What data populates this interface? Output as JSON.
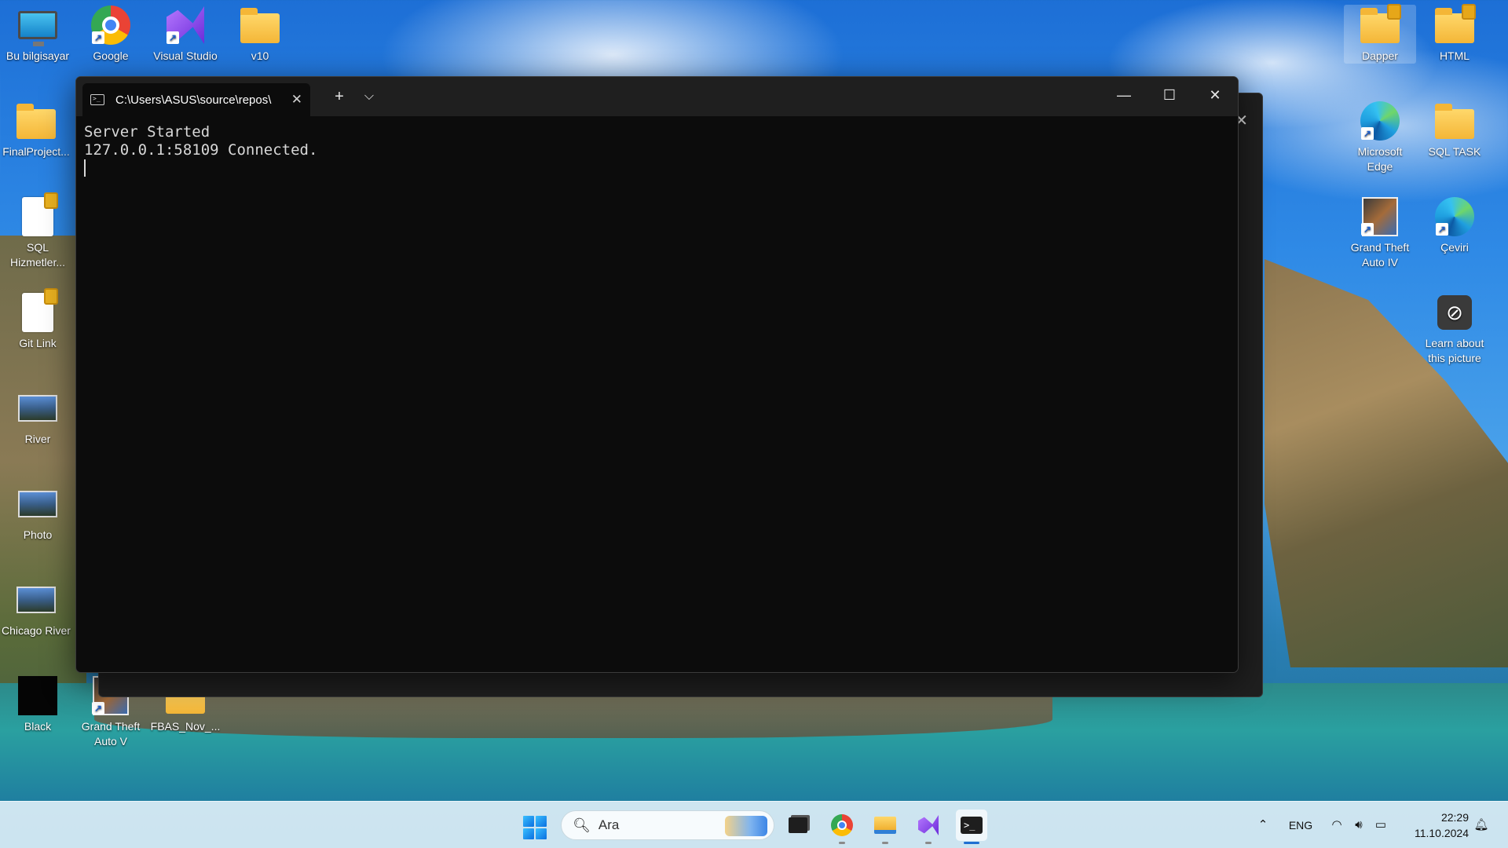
{
  "desktop": {
    "icons_left": [
      {
        "label": "Bu bilgisayar",
        "icon": "computer-icon"
      },
      {
        "label": "Google Chrome",
        "icon": "chrome-icon"
      },
      {
        "label": "Visual Studio 2022",
        "icon": "visual-studio-icon"
      },
      {
        "label": "v10",
        "icon": "folder-icon"
      },
      {
        "label": "FinalProject...",
        "icon": "folder-icon"
      },
      {
        "label": "SQL Hizmetler...",
        "icon": "document-icon"
      },
      {
        "label": "Git Link",
        "icon": "document-icon"
      },
      {
        "label": "River",
        "icon": "image-icon"
      },
      {
        "label": "Photo",
        "icon": "image-icon"
      },
      {
        "label": "Chicago River",
        "icon": "image-icon"
      },
      {
        "label": "Black",
        "icon": "image-icon"
      },
      {
        "label": "Grand Theft Auto V",
        "icon": "game-icon"
      },
      {
        "label": "FBAS_Nov_...",
        "icon": "folder-icon"
      }
    ],
    "icons_right": [
      {
        "label": "Dapper",
        "icon": "folder-icon"
      },
      {
        "label": "HTML",
        "icon": "folder-icon"
      },
      {
        "label": "Microsoft Edge",
        "icon": "edge-icon"
      },
      {
        "label": "SQL TASK",
        "icon": "folder-icon"
      },
      {
        "label": "Grand Theft Auto IV",
        "icon": "game-icon"
      },
      {
        "label": "Çeviri",
        "icon": "edge-icon"
      },
      {
        "label": "Learn about this picture",
        "icon": "camera-icon"
      }
    ]
  },
  "terminal": {
    "tab_title": "C:\\Users\\ASUS\\source\\repos\\",
    "new_tab_symbol": "+",
    "dropdown_symbol": "⌵",
    "lines": [
      "Server Started",
      "127.0.0.1:58109 Connected."
    ]
  },
  "taskbar": {
    "search_placeholder": "Ara",
    "language": "ENG",
    "time": "22:29",
    "date": "11.10.2024"
  }
}
